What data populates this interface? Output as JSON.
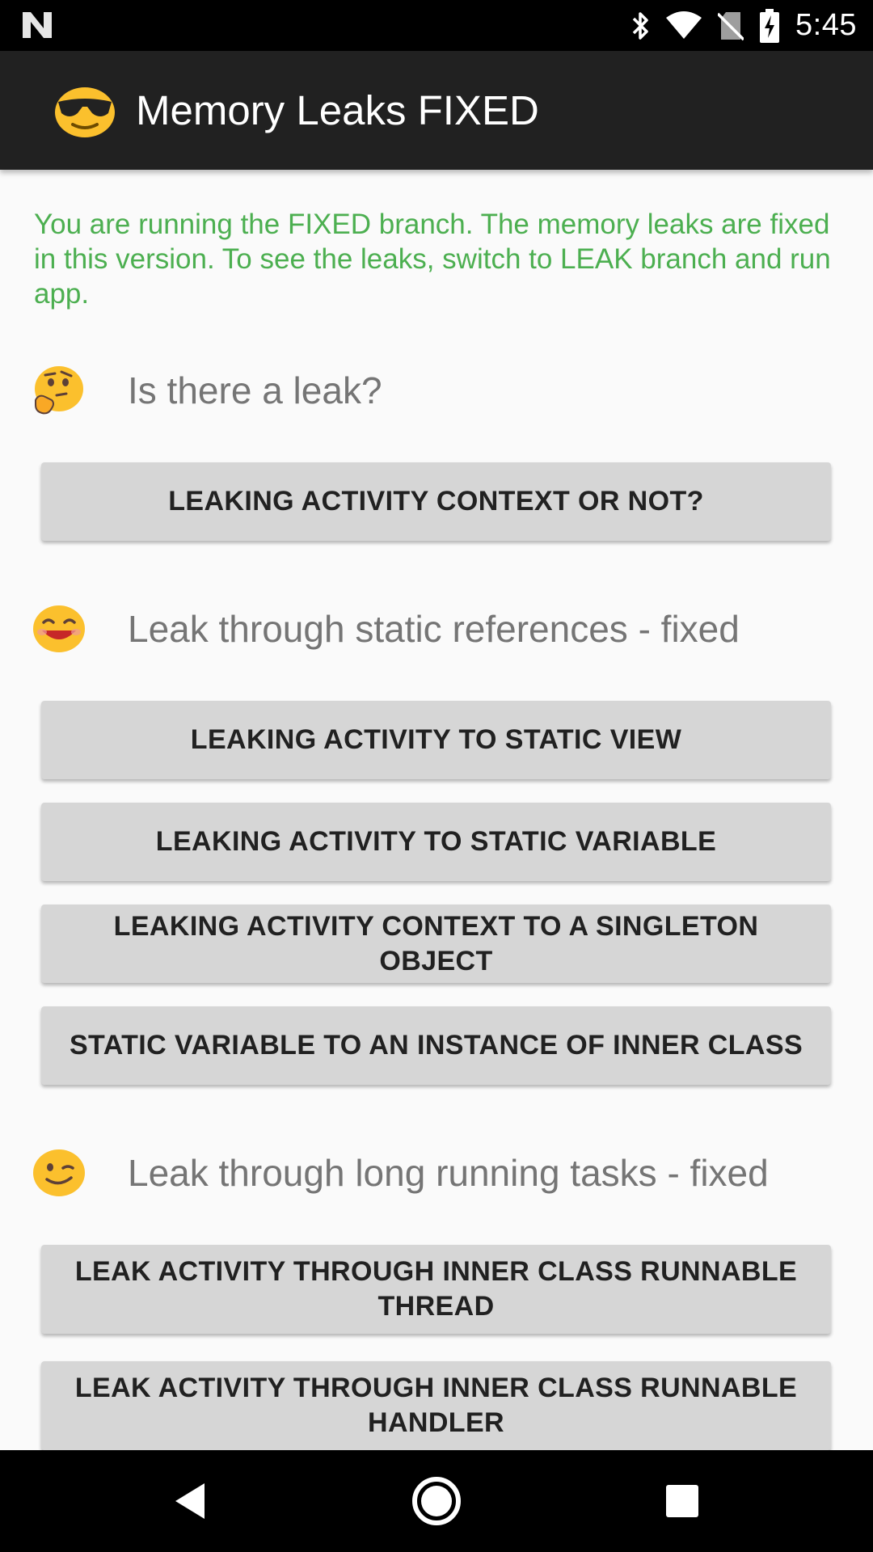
{
  "status_bar": {
    "time": "5:45",
    "icons": [
      "notification-n-icon",
      "bluetooth-icon",
      "wifi-icon",
      "no-sim-icon",
      "battery-charging-icon"
    ]
  },
  "app_bar": {
    "title": "Memory Leaks FIXED",
    "logo_icon": "sunglasses-emoji-icon"
  },
  "content": {
    "info_text": "You are running the FIXED branch. The memory leaks are fixed in this version. To see the leaks, switch to LEAK branch and run app.",
    "sections": [
      {
        "emoji": "thinking-emoji-icon",
        "title": "Is there a leak?",
        "buttons": [
          "LEAKING ACTIVITY CONTEXT OR NOT?"
        ]
      },
      {
        "emoji": "smiling-emoji-icon",
        "title": "Leak through static references - fixed",
        "buttons": [
          "LEAKING ACTIVITY TO STATIC VIEW",
          "LEAKING ACTIVITY TO STATIC VARIABLE",
          "LEAKING ACTIVITY CONTEXT TO A SINGLETON OBJECT",
          "STATIC VARIABLE TO AN INSTANCE OF INNER CLASS"
        ]
      },
      {
        "emoji": "winking-emoji-icon",
        "title": "Leak through long running tasks - fixed",
        "buttons": [
          "LEAK ACTIVITY THROUGH INNER CLASS RUNNABLE THREAD",
          "LEAK ACTIVITY THROUGH INNER CLASS RUNNABLE HANDLER"
        ]
      }
    ]
  },
  "nav_bar": {
    "icons": [
      "back-icon",
      "home-icon",
      "recents-icon"
    ]
  },
  "colors": {
    "status_bar": "#000000",
    "app_bar": "#212121",
    "info_text": "#4caf50",
    "section_title": "#757575",
    "button_bg": "#d6d6d6",
    "button_text": "#212121",
    "background": "#fafafa"
  }
}
